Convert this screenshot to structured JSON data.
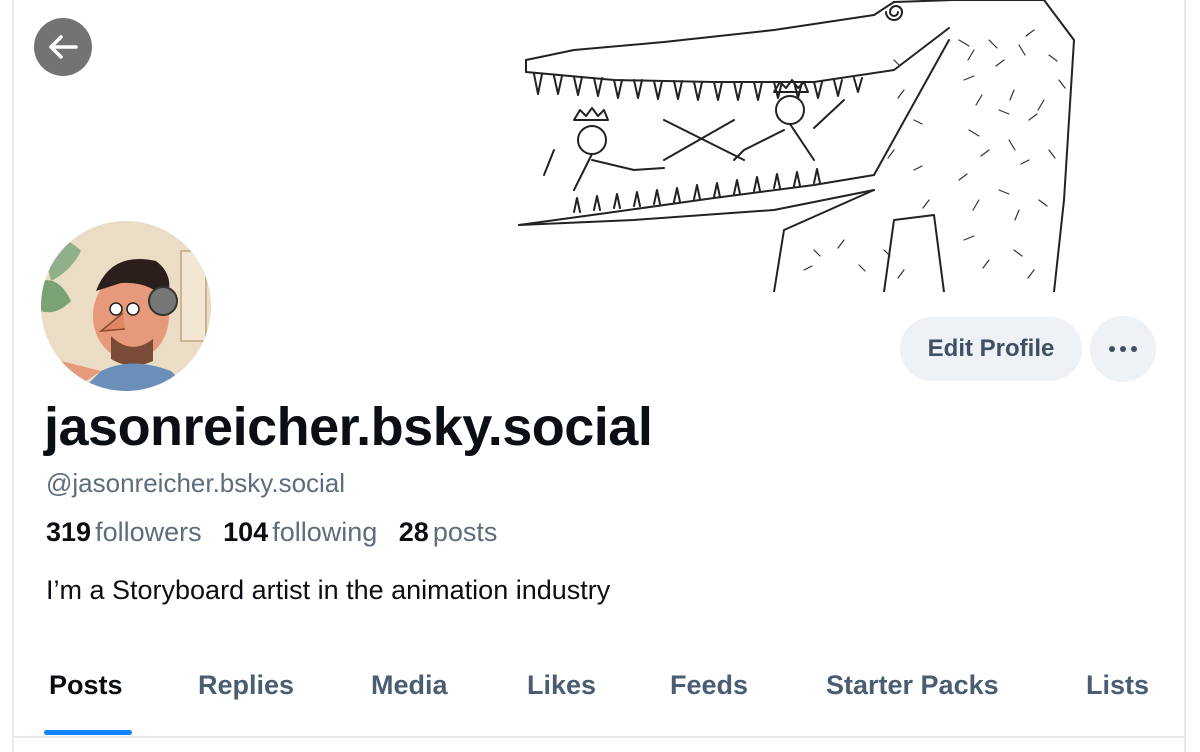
{
  "profile": {
    "display_name": "jasonreicher.bsky.social",
    "handle": "@jasonreicher.bsky.social",
    "bio": "I’m a Storyboard artist in the animation industry",
    "stats": {
      "followers_count": "319",
      "followers_label": "followers",
      "following_count": "104",
      "following_label": "following",
      "posts_count": "28",
      "posts_label": "posts"
    }
  },
  "actions": {
    "edit_profile_label": "Edit Profile",
    "more_icon": "ellipsis-icon",
    "back_icon": "arrow-left-icon"
  },
  "tabs": [
    {
      "label": "Posts",
      "active": true
    },
    {
      "label": "Replies"
    },
    {
      "label": "Media"
    },
    {
      "label": "Likes"
    },
    {
      "label": "Feeds"
    },
    {
      "label": "Starter Packs"
    },
    {
      "label": "Lists"
    }
  ],
  "colors": {
    "accent": "#1083fe",
    "muted_text": "#5d6d7e",
    "button_bg": "#eef1f5"
  }
}
